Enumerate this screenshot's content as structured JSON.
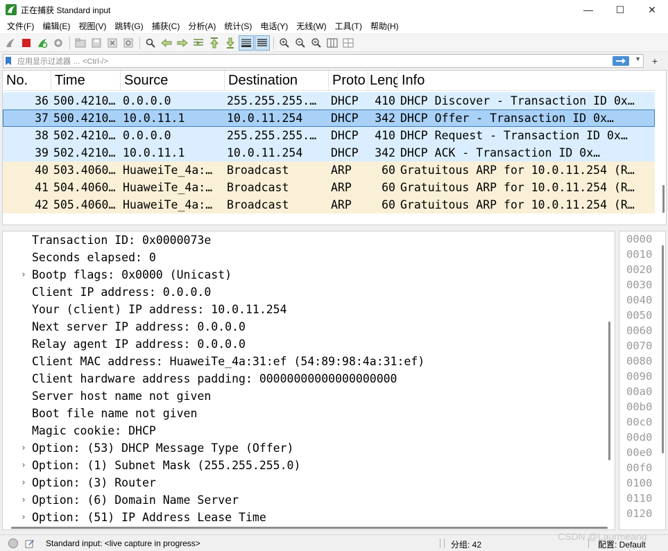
{
  "window": {
    "title": "正在捕获 Standard input",
    "controls": [
      "—",
      "☐",
      "✕"
    ]
  },
  "menu": [
    "文件(F)",
    "编辑(E)",
    "视图(V)",
    "跳转(G)",
    "捕获(C)",
    "分析(A)",
    "统计(S)",
    "电话(Y)",
    "无线(W)",
    "工具(T)",
    "帮助(H)"
  ],
  "filter": {
    "placeholder": "应用显示过滤器 … <Ctrl-/>",
    "add_label": "+"
  },
  "packet_list": {
    "columns": [
      "No.",
      "Time",
      "Source",
      "Destination",
      "Proto",
      "Leng",
      "Info"
    ],
    "rows": [
      {
        "no": "36",
        "time": "500.4210…",
        "source": "0.0.0.0",
        "destination": "255.255.255.…",
        "protocol": "DHCP",
        "length": "410",
        "info": "DHCP Discover  - Transaction ID 0x…",
        "kind": "dhcp",
        "selected": false
      },
      {
        "no": "37",
        "time": "500.4210…",
        "source": "10.0.11.1",
        "destination": "10.0.11.254",
        "protocol": "DHCP",
        "length": "342",
        "info": "DHCP Offer     - Transaction ID 0x…",
        "kind": "dhcp",
        "selected": true
      },
      {
        "no": "38",
        "time": "502.4210…",
        "source": "0.0.0.0",
        "destination": "255.255.255.…",
        "protocol": "DHCP",
        "length": "410",
        "info": "DHCP Request   - Transaction ID 0x…",
        "kind": "dhcp",
        "selected": false
      },
      {
        "no": "39",
        "time": "502.4210…",
        "source": "10.0.11.1",
        "destination": "10.0.11.254",
        "protocol": "DHCP",
        "length": "342",
        "info": "DHCP ACK       - Transaction ID 0x…",
        "kind": "dhcp",
        "selected": false
      },
      {
        "no": "40",
        "time": "503.4060…",
        "source": "HuaweiTe_4a:…",
        "destination": "Broadcast",
        "protocol": "ARP",
        "length": "60",
        "info": "Gratuitous ARP for 10.0.11.254 (R…",
        "kind": "arp",
        "selected": false
      },
      {
        "no": "41",
        "time": "504.4060…",
        "source": "HuaweiTe_4a:…",
        "destination": "Broadcast",
        "protocol": "ARP",
        "length": "60",
        "info": "Gratuitous ARP for 10.0.11.254 (R…",
        "kind": "arp",
        "selected": false
      },
      {
        "no": "42",
        "time": "505.4060…",
        "source": "HuaweiTe_4a:…",
        "destination": "Broadcast",
        "protocol": "ARP",
        "length": "60",
        "info": "Gratuitous ARP for 10.0.11.254 (R…",
        "kind": "arp",
        "selected": false
      }
    ]
  },
  "details": [
    {
      "text": "Transaction ID: 0x0000073e",
      "expandable": false
    },
    {
      "text": "Seconds elapsed: 0",
      "expandable": false
    },
    {
      "text": "Bootp flags: 0x0000 (Unicast)",
      "expandable": true
    },
    {
      "text": "Client IP address: 0.0.0.0",
      "expandable": false
    },
    {
      "text": "Your (client) IP address: 10.0.11.254",
      "expandable": false
    },
    {
      "text": "Next server IP address: 0.0.0.0",
      "expandable": false
    },
    {
      "text": "Relay agent IP address: 0.0.0.0",
      "expandable": false
    },
    {
      "text": "Client MAC address: HuaweiTe_4a:31:ef (54:89:98:4a:31:ef)",
      "expandable": false
    },
    {
      "text": "Client hardware address padding: 00000000000000000000",
      "expandable": false
    },
    {
      "text": "Server host name not given",
      "expandable": false
    },
    {
      "text": "Boot file name not given",
      "expandable": false
    },
    {
      "text": "Magic cookie: DHCP",
      "expandable": false
    },
    {
      "text": "Option: (53) DHCP Message Type (Offer)",
      "expandable": true
    },
    {
      "text": "Option: (1) Subnet Mask (255.255.255.0)",
      "expandable": true
    },
    {
      "text": "Option: (3) Router",
      "expandable": true
    },
    {
      "text": "Option: (6) Domain Name Server",
      "expandable": true
    },
    {
      "text": "Option: (51) IP Address Lease Time",
      "expandable": true
    }
  ],
  "bytes_offsets": [
    "0000",
    "0010",
    "0020",
    "0030",
    "0040",
    "0050",
    "0060",
    "0070",
    "0080",
    "0090",
    "00a0",
    "00b0",
    "00c0",
    "00d0",
    "00e0",
    "00f0",
    "0100",
    "0110",
    "0120"
  ],
  "status": {
    "capture_text": "Standard input: <live capture in progress>",
    "packets_text": "分组: 42",
    "profile_text": "配置: Default"
  },
  "watermark": "CSDN @Laurmeang",
  "colors": {
    "dhcp_row": "#daeeff",
    "arp_row": "#faf0d7",
    "selected_row": "#a9d1f7",
    "apply_button": "#4a8fd8"
  }
}
